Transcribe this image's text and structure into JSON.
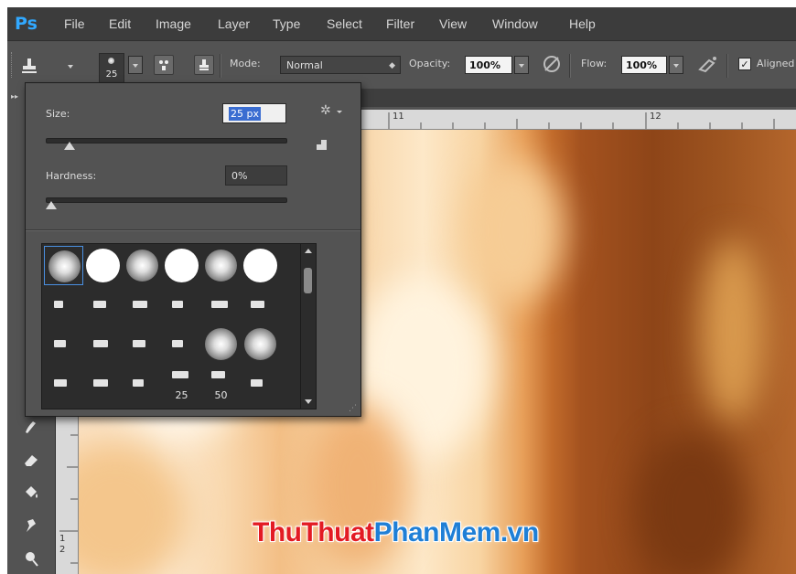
{
  "app": {
    "logo": "Ps",
    "menu": [
      "File",
      "Edit",
      "Image",
      "Layer",
      "Type",
      "Select",
      "Filter",
      "View",
      "Window",
      "Help"
    ]
  },
  "options_bar": {
    "brush_size": "25",
    "mode_label": "Mode:",
    "mode_value": "Normal",
    "opacity_label": "Opacity:",
    "opacity_value": "100%",
    "flow_label": "Flow:",
    "flow_value": "100%",
    "aligned_label": "Aligned",
    "aligned_checked": "✓"
  },
  "brush_picker": {
    "size_label": "Size:",
    "size_value": "25 px",
    "size_slider_fraction": 0.1,
    "hardness_label": "Hardness:",
    "hardness_value": "0%",
    "hardness_slider_fraction": 0.0,
    "presets": [
      {
        "kind": "soft",
        "label": ""
      },
      {
        "kind": "hard",
        "label": ""
      },
      {
        "kind": "soft",
        "label": ""
      },
      {
        "kind": "hard",
        "label": ""
      },
      {
        "kind": "soft",
        "label": ""
      },
      {
        "kind": "hard",
        "label": ""
      },
      {
        "kind": "tip",
        "label": ""
      },
      {
        "kind": "tip",
        "label": ""
      },
      {
        "kind": "tip",
        "label": ""
      },
      {
        "kind": "tip",
        "label": ""
      },
      {
        "kind": "tip",
        "label": ""
      },
      {
        "kind": "tip",
        "label": ""
      },
      {
        "kind": "tip",
        "label": ""
      },
      {
        "kind": "tip",
        "label": ""
      },
      {
        "kind": "tip",
        "label": ""
      },
      {
        "kind": "tip",
        "label": ""
      },
      {
        "kind": "soft",
        "label": ""
      },
      {
        "kind": "soft",
        "label": ""
      },
      {
        "kind": "tip",
        "label": ""
      },
      {
        "kind": "tip",
        "label": ""
      },
      {
        "kind": "tip",
        "label": ""
      },
      {
        "kind": "tip",
        "label": "25"
      },
      {
        "kind": "tip",
        "label": "50"
      },
      {
        "kind": "tip",
        "label": ""
      }
    ]
  },
  "ruler": {
    "top": [
      "11",
      "12"
    ],
    "left": [
      "1",
      "2"
    ]
  },
  "watermark": {
    "part1": "ThuThuat",
    "part2": "PhanMem.vn"
  },
  "colors": {
    "accent": "#31a8ff",
    "selection": "#3a6dd1",
    "watermark_red": "#e31b23",
    "watermark_blue": "#1f7fd6"
  }
}
